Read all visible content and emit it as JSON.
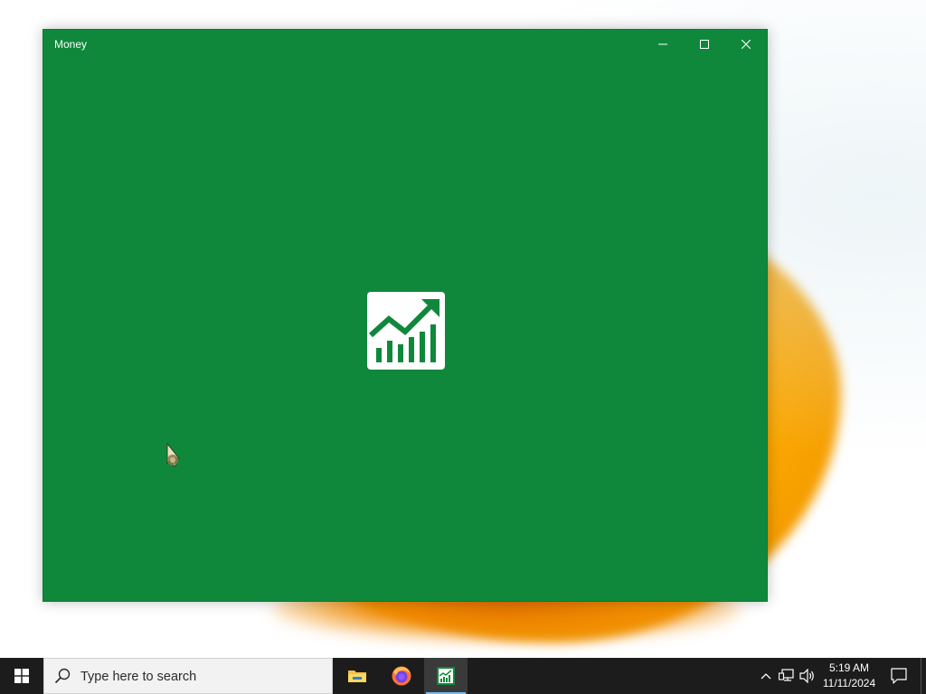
{
  "window": {
    "title": "Money",
    "accent_color": "#0f883c",
    "controls": {
      "minimize_icon": "minimize-icon",
      "maximize_icon": "maximize-icon",
      "close_icon": "close-icon"
    },
    "splash_icon": "money-chart-logo-icon"
  },
  "taskbar": {
    "start_icon": "windows-logo-icon",
    "search": {
      "placeholder": "Type here to search",
      "icon": "search-icon"
    },
    "pinned_apps": [
      {
        "name": "File Explorer",
        "icon": "folder-icon"
      },
      {
        "name": "Firefox",
        "icon": "firefox-icon"
      },
      {
        "name": "Money",
        "icon": "money-app-icon",
        "active": true
      }
    ],
    "tray": {
      "chevron_icon": "chevron-up-icon",
      "network_icon": "network-icon",
      "volume_icon": "volume-icon"
    },
    "clock": {
      "time": "5:19 AM",
      "date": "11/11/2024"
    },
    "notification_icon": "notification-icon"
  }
}
